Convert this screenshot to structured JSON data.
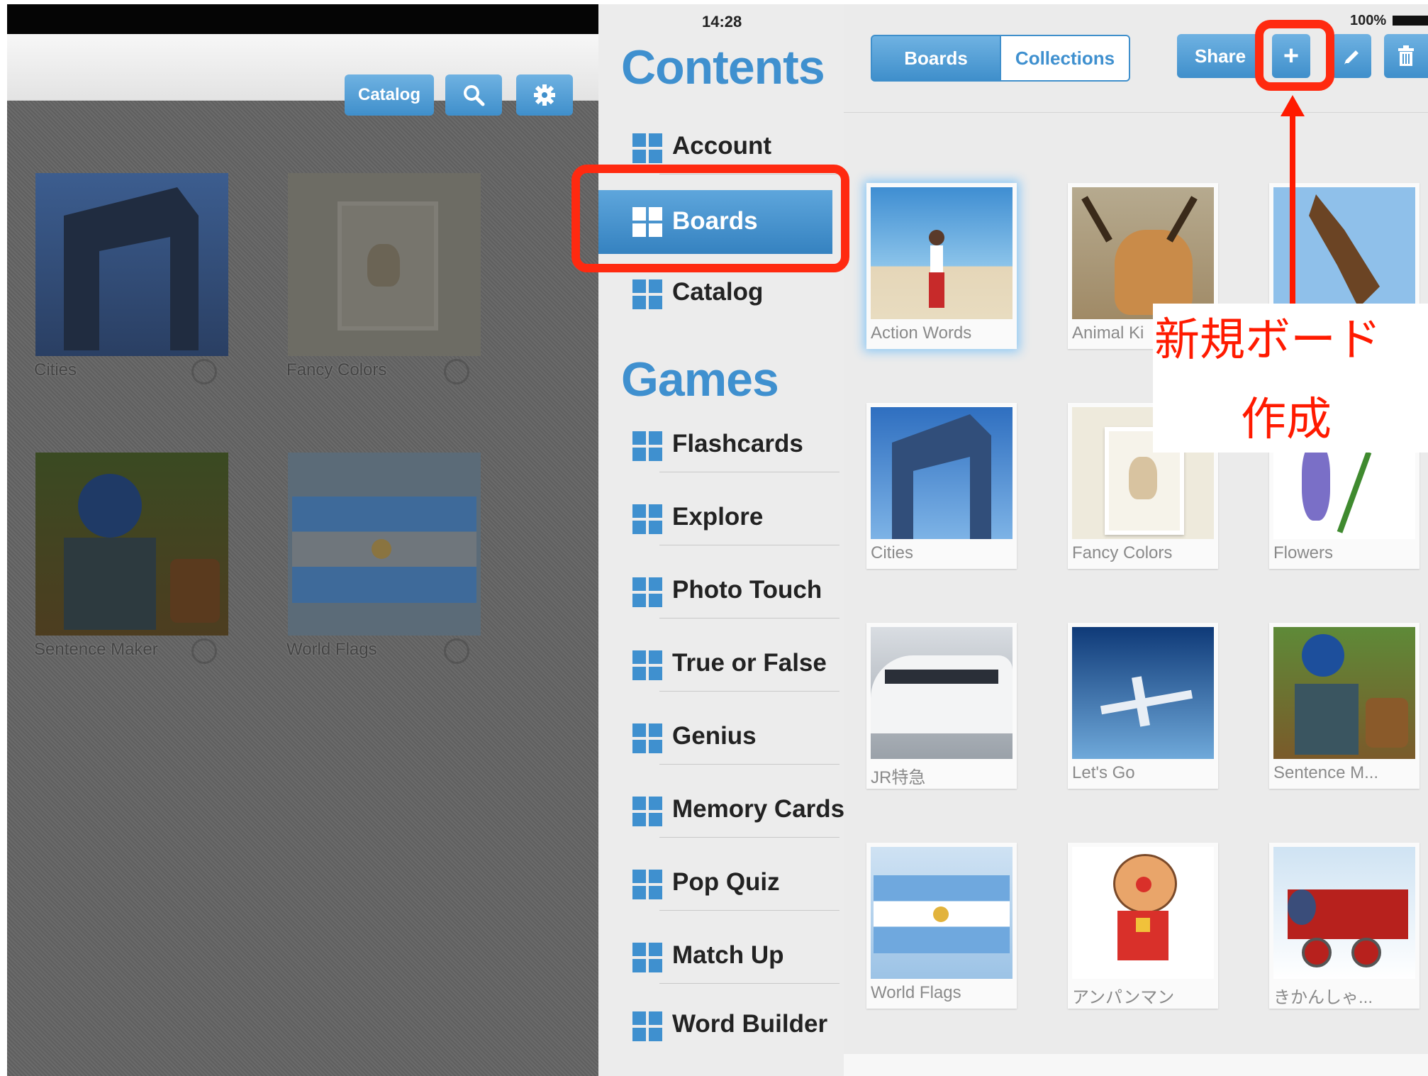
{
  "status_bar": {
    "time": "14:28",
    "battery": "100%"
  },
  "left_app": {
    "toolbar": {
      "catalog_label": "Catalog"
    },
    "cards": [
      {
        "caption": "Cities"
      },
      {
        "caption": "Fancy Colors"
      },
      {
        "caption": "Sentence Maker"
      },
      {
        "caption": "World Flags"
      }
    ]
  },
  "menu": {
    "contents_title": "Contents",
    "contents_items": [
      {
        "label": "Account"
      },
      {
        "label": "Boards"
      },
      {
        "label": "Catalog"
      }
    ],
    "games_title": "Games",
    "games_items": [
      {
        "label": "Flashcards"
      },
      {
        "label": "Explore"
      },
      {
        "label": "Photo Touch"
      },
      {
        "label": "True or False"
      },
      {
        "label": "Genius"
      },
      {
        "label": "Memory Cards"
      },
      {
        "label": "Pop Quiz"
      },
      {
        "label": "Match Up"
      },
      {
        "label": "Word Builder"
      }
    ]
  },
  "boards_pane": {
    "segment": {
      "boards_label": "Boards",
      "collections_label": "Collections"
    },
    "toolbar": {
      "share_label": "Share",
      "add_label": "+"
    },
    "boards": [
      {
        "caption": "Action Words"
      },
      {
        "caption": "Animal Ki"
      },
      {
        "caption": ""
      },
      {
        "caption": "Cities"
      },
      {
        "caption": "Fancy Colors"
      },
      {
        "caption": "Flowers"
      },
      {
        "caption": "JR特急"
      },
      {
        "caption": "Let's Go"
      },
      {
        "caption": "Sentence M..."
      },
      {
        "caption": "World Flags"
      },
      {
        "caption": "アンパンマン"
      },
      {
        "caption": "きかんしゃ..."
      }
    ]
  },
  "annotation": {
    "line1": "新規ボード",
    "line2": "作成",
    "color": "#ff1a00"
  }
}
